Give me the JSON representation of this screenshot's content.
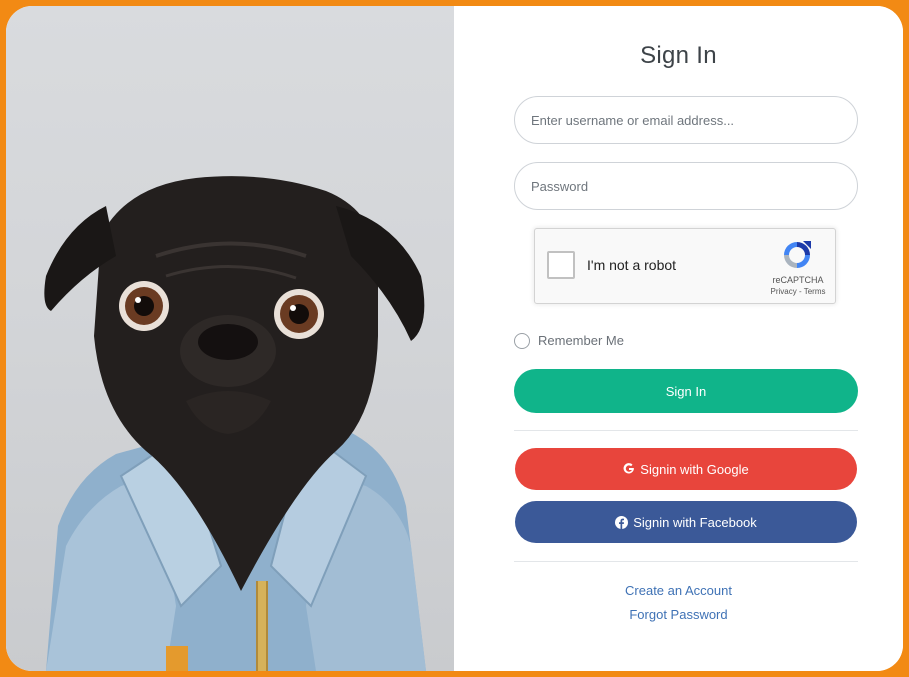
{
  "form": {
    "title": "Sign In",
    "username_placeholder": "Enter username or email address...",
    "password_placeholder": "Password",
    "remember_label": "Remember Me",
    "signin_label": "Sign In"
  },
  "captcha": {
    "label": "I'm not a robot",
    "brand": "reCAPTCHA",
    "links": "Privacy - Terms"
  },
  "social": {
    "google_label": "Signin with Google",
    "facebook_label": "Signin with Facebook"
  },
  "links": {
    "create_account": "Create an Account",
    "forgot_password": "Forgot Password"
  },
  "colors": {
    "frame": "#f28a14",
    "signin": "#10b48a",
    "google": "#e8453c",
    "facebook": "#3b5998",
    "link": "#3f72b5"
  },
  "icons": [
    "google-icon",
    "facebook-icon",
    "recaptcha-logo-icon"
  ]
}
